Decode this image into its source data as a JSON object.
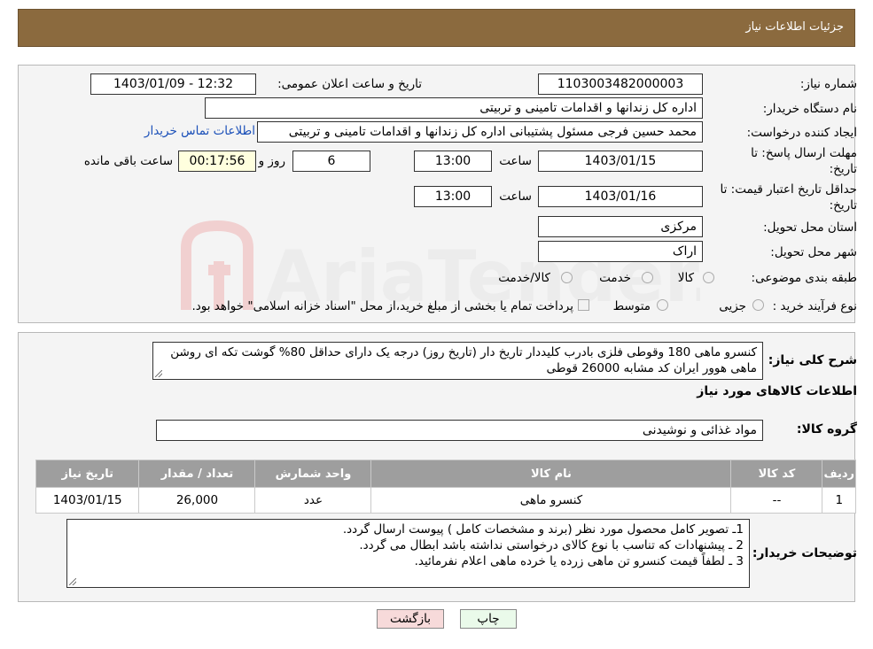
{
  "header": {
    "title": "جزئیات اطلاعات نیاز"
  },
  "fields": {
    "need_number_label": "شماره نیاز:",
    "need_number": "1103003482000003",
    "announce_label": "تاریخ و ساعت اعلان عمومی:",
    "announce_value": "1403/01/09 - 12:32",
    "buyer_org_label": "نام دستگاه خریدار:",
    "buyer_org": "اداره کل زندانها و اقدامات تامینی و تربیتی",
    "requester_label": "ایجاد کننده درخواست:",
    "requester": "محمد حسین فرجی مسئول پشتیبانی اداره کل زندانها و اقدامات تامینی و تربیتی",
    "contact_link": "اطلاعات تماس خریدار",
    "deadline_label": "مهلت ارسال پاسخ: تا",
    "deadline_label2": "تاریخ:",
    "deadline_date": "1403/01/15",
    "time_label": "ساعت",
    "deadline_time": "13:00",
    "days": "6",
    "days_label": "روز و",
    "remaining": "00:17:56",
    "remaining_label": "ساعت باقی مانده",
    "validity_label": "حداقل تاریخ اعتبار قیمت: تا",
    "validity_label2": "تاریخ:",
    "validity_date": "1403/01/16",
    "validity_time": "13:00",
    "province_label": "استان محل تحویل:",
    "province": "مرکزی",
    "city_label": "شهر محل تحویل:",
    "city": "اراک",
    "category_label": "طبقه بندی موضوعی:",
    "cat_goods": "کالا",
    "cat_service": "خدمت",
    "cat_both": "کالا/خدمت",
    "process_label": "نوع فرآیند خرید :",
    "proc_small": "جزیی",
    "proc_medium": "متوسط",
    "proc_note": "پرداخت تمام یا بخشی از مبلغ خرید،از محل \"اسناد خزانه اسلامی\" خواهد بود."
  },
  "description": {
    "label": "شرح کلی نیاز:",
    "text": "کنسرو ماهی 180 وقوطی فلزی بادرب کلیددار تاریخ دار (تاریخ روز) درجه یک دارای حداقل 80% گوشت تکه ای روشن ماهی هوور ایران کد مشابه 26000 قوطی"
  },
  "goods": {
    "section_title": "اطلاعات کالاهای مورد نیاز",
    "group_label": "گروه کالا:",
    "group_value": "مواد غذائی و نوشیدنی",
    "columns": [
      "ردیف",
      "کد کالا",
      "نام کالا",
      "واحد شمارش",
      "تعداد / مقدار",
      "تاریخ نیاز"
    ],
    "rows": [
      [
        "1",
        "--",
        "کنسرو ماهی",
        "عدد",
        "26,000",
        "1403/01/15"
      ]
    ]
  },
  "buyer_notes": {
    "label": "توضیحات خریدار:",
    "lines": [
      "1ـ تصویر کامل محصول مورد نظر (برند و مشخصات کامل ) پیوست ارسال گردد.",
      "2 ـ پیشنهادات که تناسب با نوع کالای درخواستی نداشته باشد ابطال می گردد.",
      "3 ـ لطفاً قیمت کنسرو تن ماهی زرده یا خرده ماهی اعلام نفرمائید."
    ]
  },
  "buttons": {
    "print": "چاپ",
    "back": "بازگشت"
  },
  "watermark": {
    "text": "AriaTender.neT"
  },
  "colors": {
    "header": "#8b6a3e",
    "table_header": "#9e9e9e",
    "link": "#1a4fb8",
    "back_button": "#f7dada",
    "print_button": "#eafaea"
  }
}
